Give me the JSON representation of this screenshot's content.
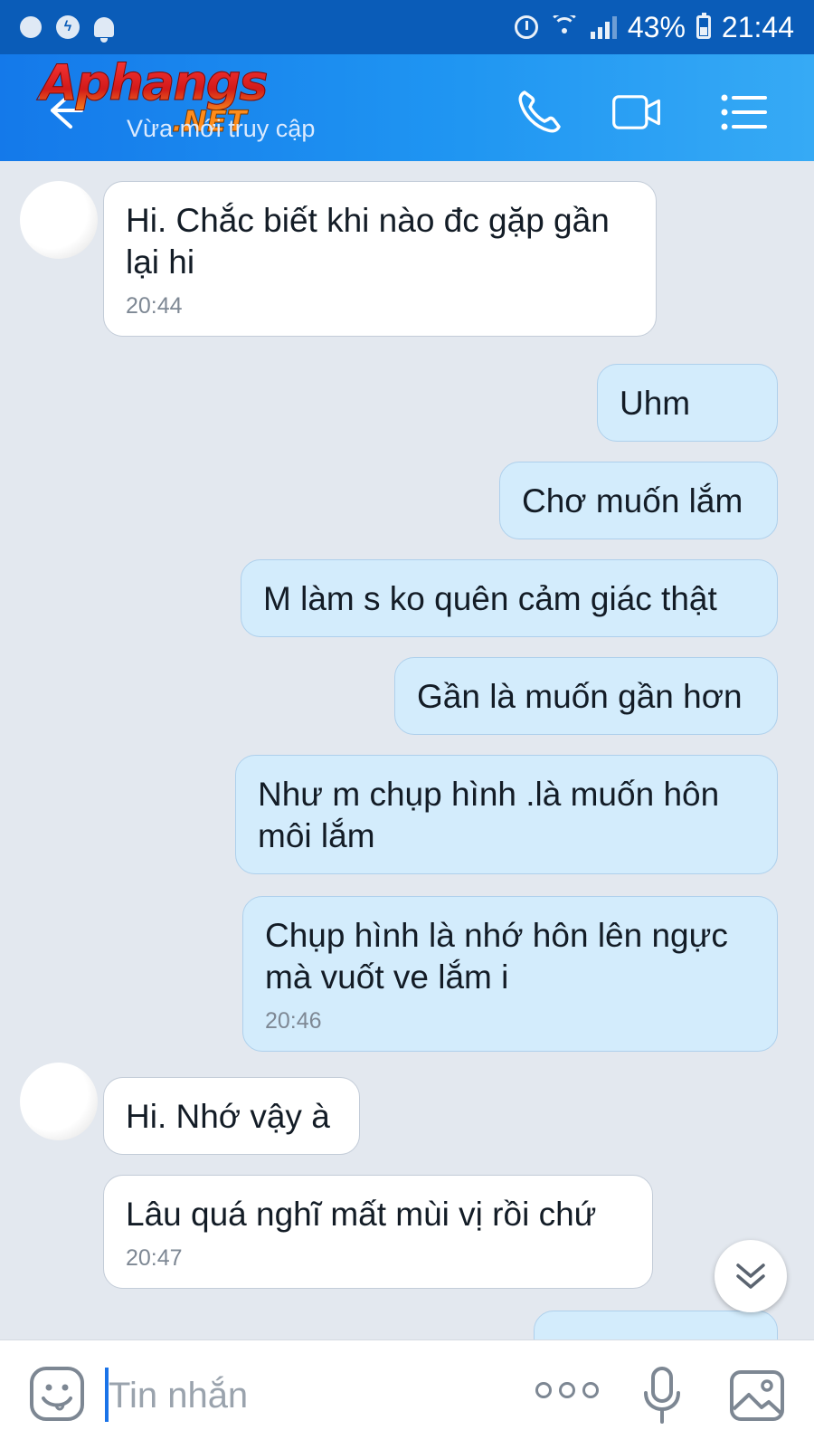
{
  "status_bar": {
    "battery": "43%",
    "time": "21:44",
    "icons": [
      "chat-bubble-icon",
      "messenger-icon",
      "bell-icon",
      "alarm-icon",
      "wifi-icon",
      "signal-icon",
      "battery-icon"
    ]
  },
  "header": {
    "logo_main": "Aphangs",
    "logo_suffix": ".NET",
    "subtitle": "Vừa mới truy cập",
    "icons": [
      "back-arrow-icon",
      "phone-icon",
      "video-camera-icon",
      "menu-list-icon"
    ]
  },
  "messages": [
    {
      "side": "in",
      "text": "Hi. Chắc biết khi nào đc gặp gần lại hi",
      "time": "20:44"
    },
    {
      "side": "out",
      "text": "Uhm",
      "time": ""
    },
    {
      "side": "out",
      "text": "Chơ muốn lắm",
      "time": ""
    },
    {
      "side": "out",
      "text": "M làm s ko quên cảm giác thật",
      "time": ""
    },
    {
      "side": "out",
      "text": "Gần là muốn gần hơn",
      "time": ""
    },
    {
      "side": "out",
      "text": "Như m chụp hình .là muốn hôn môi lắm",
      "time": ""
    },
    {
      "side": "out",
      "text": "Chụp hình là nhớ hôn lên ngực mà vuốt ve lắm i",
      "time": "20:46"
    },
    {
      "side": "in",
      "text": "Hi. Nhớ vậy à",
      "time": ""
    },
    {
      "side": "in",
      "text": "Lâu quá nghĩ mất mùi vị rồi chứ",
      "time": "20:47"
    }
  ],
  "input_bar": {
    "placeholder": "Tin nhắn",
    "value": "",
    "icons": [
      "emoji-icon",
      "more-options-icon",
      "microphone-icon",
      "image-icon"
    ]
  },
  "colors": {
    "status_bar": "#0a5cb8",
    "header_start": "#1479ea",
    "header_end": "#36aaf5",
    "chat_background": "#e3e8ef",
    "incoming_bubble": "#ffffff",
    "outgoing_bubble": "#d3ecfc",
    "caret": "#1a73e8"
  }
}
